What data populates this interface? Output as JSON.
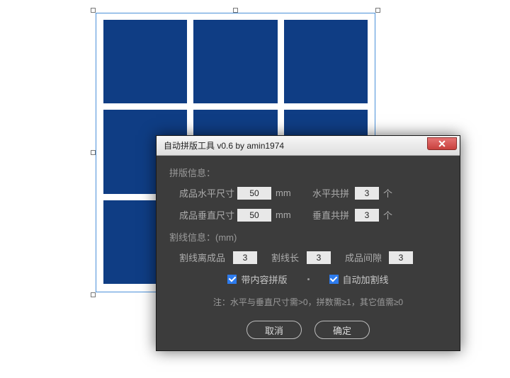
{
  "dialog": {
    "title": "自动拼版工具 v0.6   by amin1974",
    "section1": {
      "title": "拼版信息：",
      "hSizeLabel": "成品水平尺寸",
      "hSizeValue": "50",
      "hSizeUnit": "mm",
      "hCountLabel": "水平共拼",
      "hCountValue": "3",
      "hCountUnit": "个",
      "vSizeLabel": "成品垂直尺寸",
      "vSizeValue": "50",
      "vSizeUnit": "mm",
      "vCountLabel": "垂直共拼",
      "vCountValue": "3",
      "vCountUnit": "个"
    },
    "section2": {
      "title": "割线信息：(mm)",
      "offsetLabel": "割线离成品",
      "offsetValue": "3",
      "lengthLabel": "割线长",
      "lengthValue": "3",
      "gapLabel": "成品间隙",
      "gapValue": "3"
    },
    "checks": {
      "withContentLabel": "带内容拼版",
      "autoCutLabel": "自动加割线"
    },
    "note": "注：水平与垂直尺寸需>0，拼数需≥1，其它值需≥0",
    "buttons": {
      "cancel": "取消",
      "ok": "确定"
    }
  }
}
